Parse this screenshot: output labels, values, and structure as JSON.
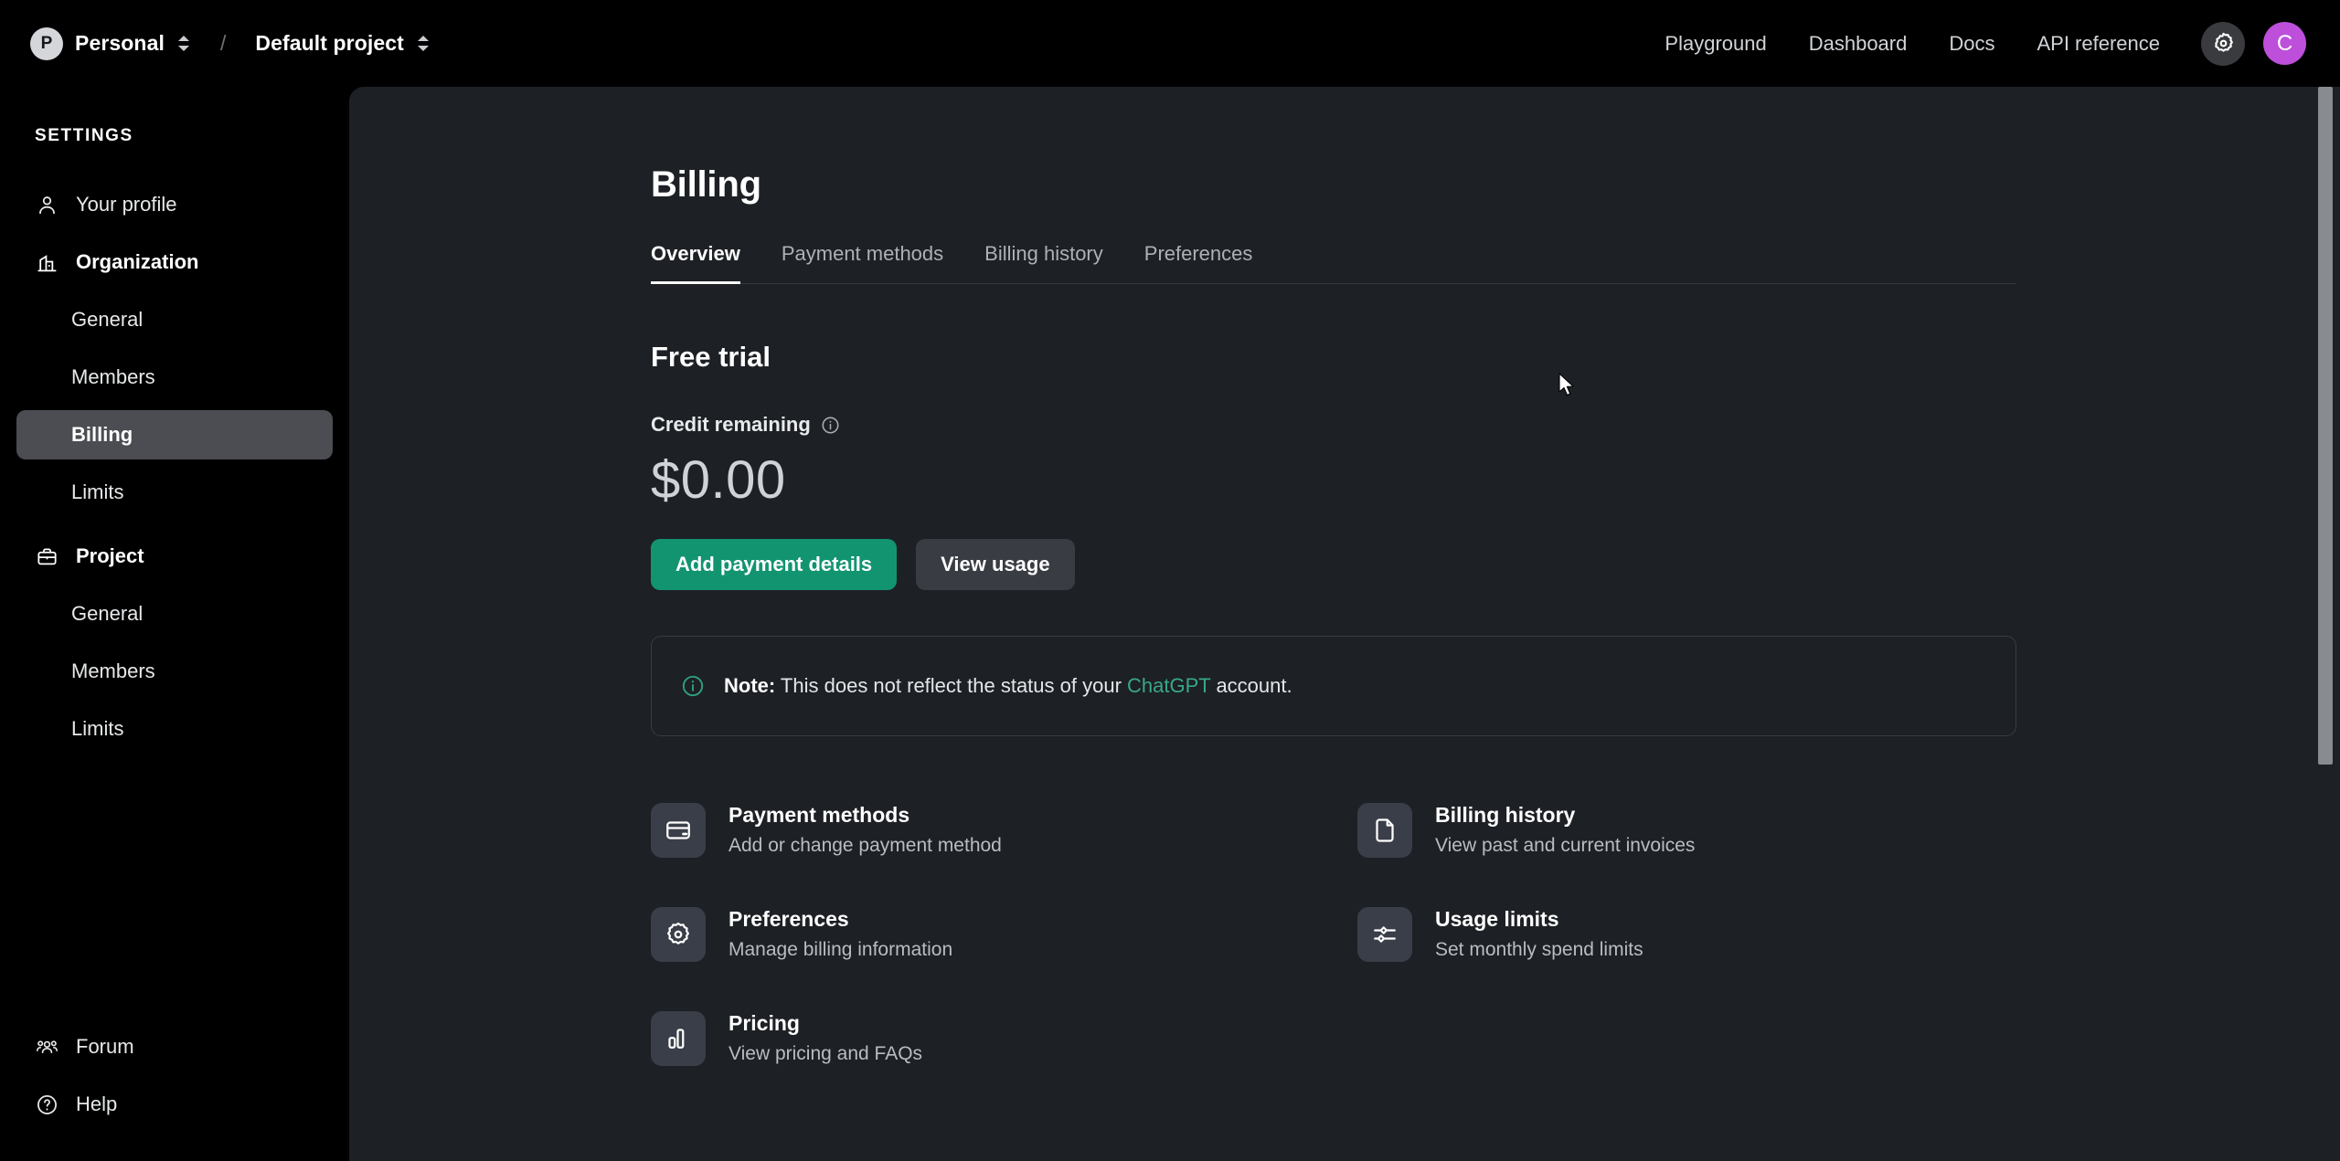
{
  "topbar": {
    "org_initial": "P",
    "org_name": "Personal",
    "separator": "/",
    "project_name": "Default project",
    "nav": [
      {
        "label": "Playground"
      },
      {
        "label": "Dashboard"
      },
      {
        "label": "Docs"
      },
      {
        "label": "API reference"
      }
    ],
    "settings_icon": "gear-icon",
    "user_initial": "C",
    "user_avatar_color": "#bd4fdb"
  },
  "sidebar": {
    "header": "SETTINGS",
    "items": [
      {
        "label": "Your profile",
        "icon": "user-icon",
        "type": "top"
      },
      {
        "label": "Organization",
        "icon": "building-icon",
        "type": "group"
      },
      {
        "label": "General",
        "type": "sub"
      },
      {
        "label": "Members",
        "type": "sub"
      },
      {
        "label": "Billing",
        "type": "sub",
        "active": true
      },
      {
        "label": "Limits",
        "type": "sub"
      },
      {
        "label": "Project",
        "icon": "briefcase-icon",
        "type": "group"
      },
      {
        "label": "General",
        "type": "sub"
      },
      {
        "label": "Members",
        "type": "sub"
      },
      {
        "label": "Limits",
        "type": "sub"
      }
    ],
    "bottom_items": [
      {
        "label": "Forum",
        "icon": "people-icon"
      },
      {
        "label": "Help",
        "icon": "question-circle-icon"
      }
    ],
    "active_highlight_color": "#4b4d52"
  },
  "main": {
    "title": "Billing",
    "tabs": [
      {
        "label": "Overview",
        "active": true
      },
      {
        "label": "Payment methods",
        "active": false
      },
      {
        "label": "Billing history",
        "active": false
      },
      {
        "label": "Preferences",
        "active": false
      }
    ],
    "plan_title": "Free trial",
    "credit_label": "Credit remaining",
    "credit_info_icon": "info-circle-icon",
    "credit_amount": "$0.00",
    "primary_button": "Add payment details",
    "secondary_button": "View usage",
    "primary_button_color": "#129471",
    "note": {
      "icon": "info-circle-icon",
      "bold": "Note:",
      "text_before": " This does not reflect the status of your ",
      "link": "ChatGPT",
      "text_after": " account.",
      "link_color": "#38a88a"
    },
    "cards": [
      {
        "title": "Payment methods",
        "subtitle": "Add or change payment method",
        "icon": "credit-card-icon"
      },
      {
        "title": "Billing history",
        "subtitle": "View past and current invoices",
        "icon": "document-icon"
      },
      {
        "title": "Preferences",
        "subtitle": "Manage billing information",
        "icon": "gear-icon"
      },
      {
        "title": "Usage limits",
        "subtitle": "Set monthly spend limits",
        "icon": "sliders-icon"
      },
      {
        "title": "Pricing",
        "subtitle": "View pricing and FAQs",
        "icon": "bar-chart-icon"
      }
    ]
  }
}
